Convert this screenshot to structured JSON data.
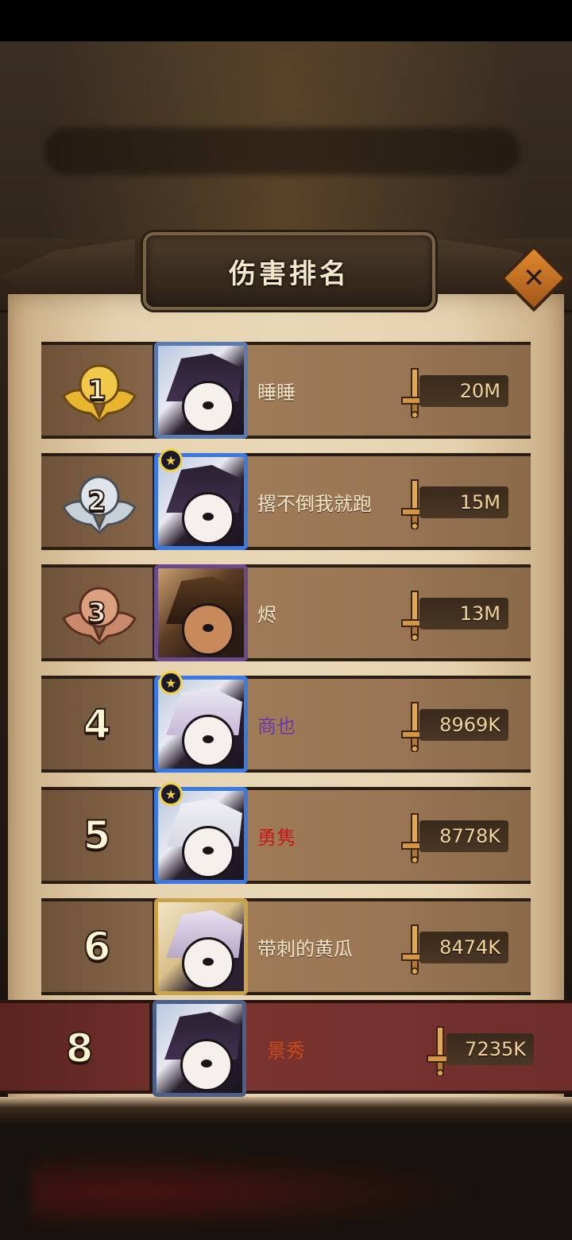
{
  "window": {
    "title": "伤害排名",
    "close_label": "✕"
  },
  "rankings": [
    {
      "rank": "1",
      "name": "睡睡",
      "damage": "20M",
      "name_color": "#f4e6cc",
      "medal": "gold"
    },
    {
      "rank": "2",
      "name": "撂不倒我就跑",
      "damage": "15M",
      "name_color": "#f4e6cc",
      "medal": "silver"
    },
    {
      "rank": "3",
      "name": "烬",
      "damage": "13M",
      "name_color": "#f4e6cc",
      "medal": "bronze"
    },
    {
      "rank": "4",
      "name": "商也",
      "damage": "8969K",
      "name_color": "#6a3aa8"
    },
    {
      "rank": "5",
      "name": "勇隽",
      "damage": "8778K",
      "name_color": "#c81818"
    },
    {
      "rank": "6",
      "name": "带刺的黄瓜",
      "damage": "8474K",
      "name_color": "#f4e6cc"
    }
  ],
  "self": {
    "rank": "8",
    "name": "景秀",
    "damage": "7235K"
  },
  "colors": {
    "gold": "#e9b530",
    "silver": "#c8d0d8",
    "bronze": "#c88a6a",
    "accent": "#e08a2e"
  }
}
